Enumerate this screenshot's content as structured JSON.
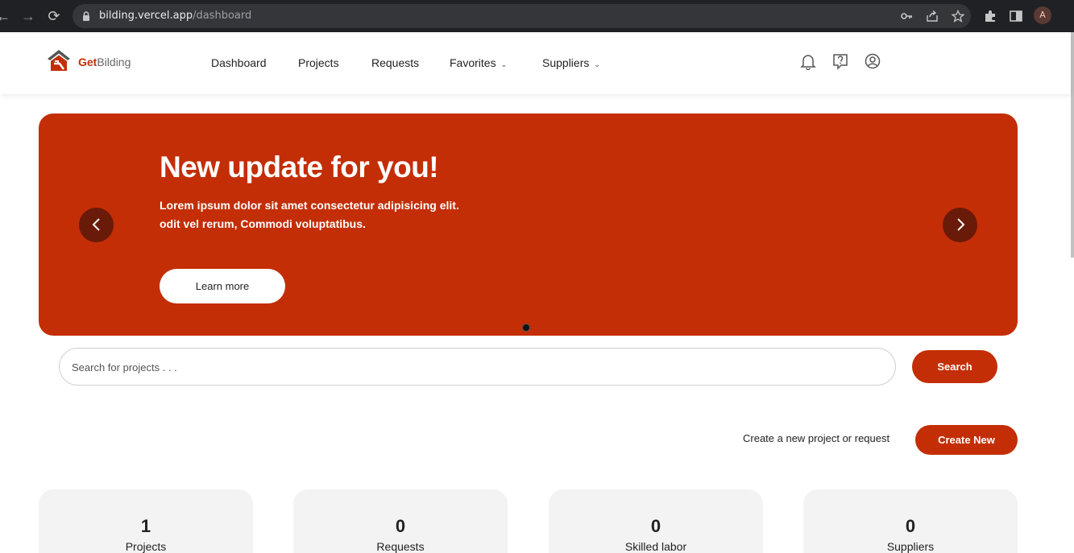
{
  "browser": {
    "url_host": "bilding.vercel.app",
    "url_path": "/dashboard",
    "profile_initial": "A"
  },
  "header": {
    "brand_primary": "Get",
    "brand_secondary": "Bilding",
    "nav": {
      "dashboard": "Dashboard",
      "projects": "Projects",
      "requests": "Requests",
      "favorites": "Favorites",
      "suppliers": "Suppliers"
    },
    "icons": [
      "bell-icon",
      "help-icon",
      "user-icon"
    ]
  },
  "banner": {
    "title": "New update for you!",
    "text_line1": "Lorem ipsum dolor sit amet consectetur adipisicing elit.",
    "text_line2": "odit vel rerum, Commodi voluptatibus.",
    "button": "Learn more",
    "slide_count": 1,
    "active_slide": 1
  },
  "search": {
    "placeholder": "Search for projects . . .",
    "value": "",
    "button": "Search"
  },
  "create": {
    "label": "Create a new project or request",
    "button": "Create New"
  },
  "stats": [
    {
      "value": "1",
      "label": "Projects"
    },
    {
      "value": "0",
      "label": "Requests"
    },
    {
      "value": "0",
      "label": "Skilled labor"
    },
    {
      "value": "0",
      "label": "Suppliers"
    }
  ],
  "colors": {
    "accent": "#c32e06",
    "arrow_bg": "#6a1a08",
    "card_bg": "#f3f3f3"
  }
}
